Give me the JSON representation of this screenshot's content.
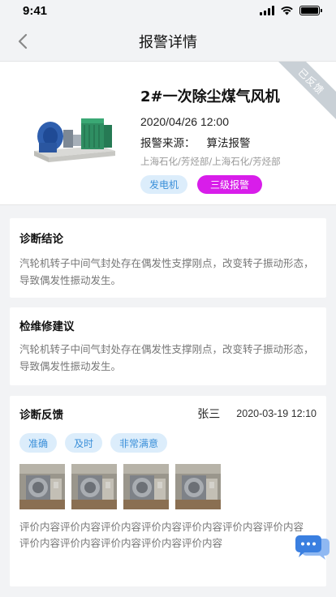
{
  "status_bar": {
    "time": "9:41"
  },
  "nav": {
    "title": "报警详情"
  },
  "alarm": {
    "ribbon": "已反馈",
    "name": "2#一次除尘煤气风机",
    "datetime": "2020/04/26 12:00",
    "source_label": "报警来源：",
    "source_value": "算法报警",
    "org_path": "上海石化/芳烃部/上海石化/芳烃部",
    "tags": [
      "发电机",
      "三级报警"
    ]
  },
  "diagnosis": {
    "title": "诊断结论",
    "text": "汽轮机转子中间气封处存在偶发性支撑刚点，改变转子振动形态，导致偶发性振动发生。"
  },
  "maintenance": {
    "title": "检维修建议",
    "text": "汽轮机转子中间气封处存在偶发性支撑刚点，改变转子振动形态，导致偶发性振动发生。"
  },
  "feedback": {
    "title": "诊断反馈",
    "person": "张三",
    "time": "2020-03-19 12:10",
    "tags": [
      "准确",
      "及时",
      "非常满意"
    ],
    "photo_count": 4,
    "text": "评价内容评价内容评价内容评价内容评价内容评价内容评价内容评价内容评价内容评价内容评价内容评价内容"
  },
  "colors": {
    "tag_blue_bg": "#dcedfb",
    "tag_blue_text": "#3a8fd9",
    "alarm_level": "#d81dea",
    "ribbon": "#c9d0d6",
    "chat_fab": "#3a7fe0"
  },
  "icons": {
    "back": "chevron-left-icon",
    "signal": "cellular-signal-icon",
    "wifi": "wifi-icon",
    "battery": "battery-icon",
    "chat": "chat-bubbles-icon"
  }
}
